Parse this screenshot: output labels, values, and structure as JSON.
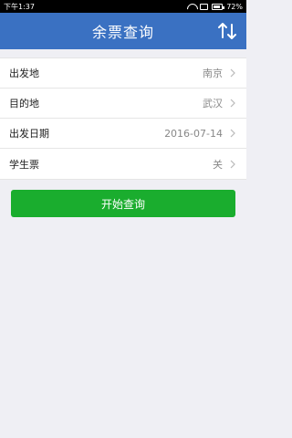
{
  "status": {
    "time": "下午1:37",
    "battery": "72%"
  },
  "header": {
    "title": "余票查询",
    "swap_icon": "swap-arrows-icon"
  },
  "form": {
    "rows": [
      {
        "label": "出发地",
        "value": "南京"
      },
      {
        "label": "目的地",
        "value": "武汉"
      },
      {
        "label": "出发日期",
        "value": "2016-07-14"
      },
      {
        "label": "学生票",
        "value": "关"
      }
    ]
  },
  "actions": {
    "search_label": "开始查询"
  },
  "colors": {
    "navbar": "#3a71c2",
    "button": "#1aad2e",
    "background": "#efeff4"
  }
}
